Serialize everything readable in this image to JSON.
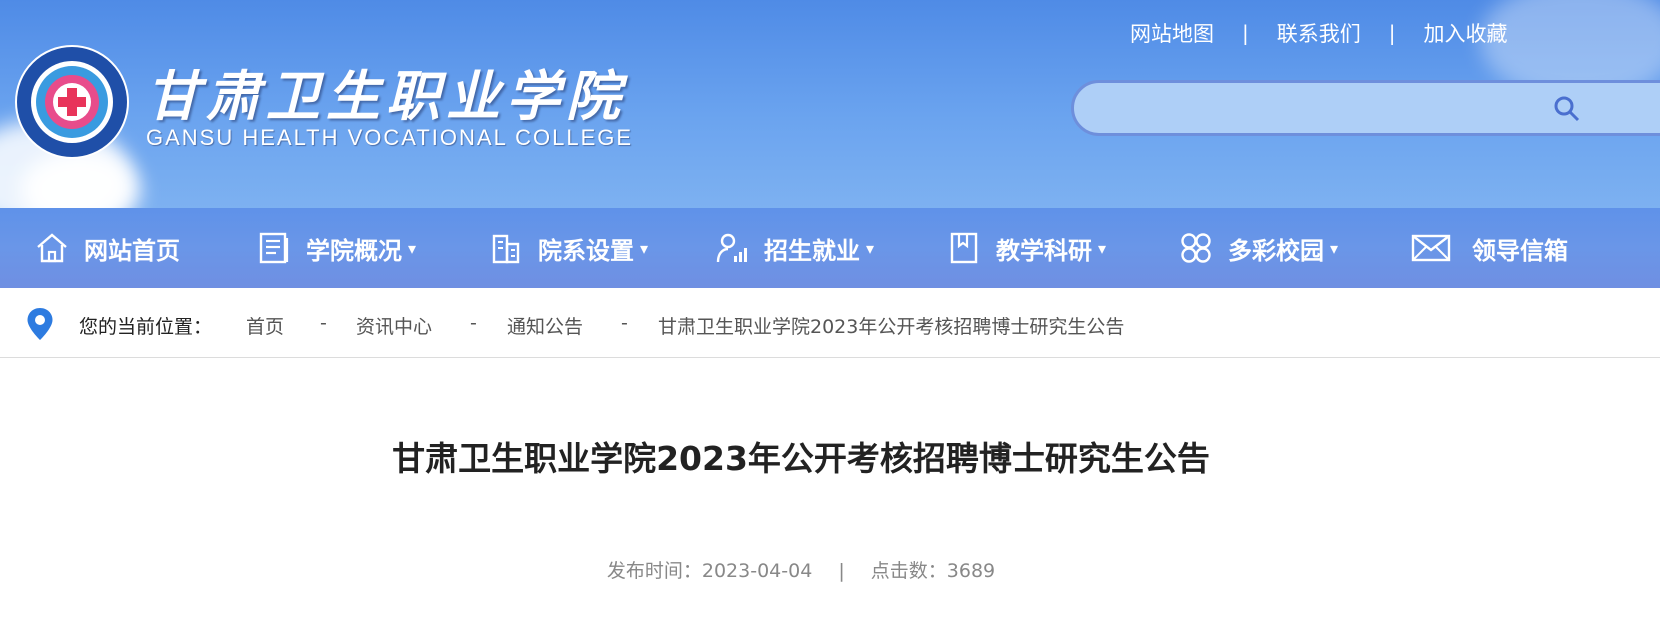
{
  "header": {
    "top_links": [
      "网站地图",
      "联系我们",
      "加入收藏"
    ],
    "separator": "|",
    "logo_cn": "甘肃卫生职业学院",
    "logo_en": "GANSU HEALTH VOCATIONAL COLLEGE",
    "emblem_text": "GANSU HEALTH VOCATIONAL COLLEGE",
    "search_placeholder": ""
  },
  "nav": {
    "items": [
      {
        "label": "网站首页",
        "icon": "home-icon"
      },
      {
        "label": "学院概况",
        "icon": "document-icon",
        "caret": "▾"
      },
      {
        "label": "院系设置",
        "icon": "building-icon",
        "caret": "▾"
      },
      {
        "label": "招生就业",
        "icon": "person-chart-icon",
        "caret": "▾"
      },
      {
        "label": "教学科研",
        "icon": "book-icon",
        "caret": "▾"
      },
      {
        "label": "多彩校园",
        "icon": "grid-circles-icon",
        "caret": "▾"
      },
      {
        "label": "领导信箱",
        "icon": "mail-icon"
      }
    ]
  },
  "breadcrumb": {
    "label": "您的当前位置：",
    "items": [
      "首页",
      "资讯中心",
      "通知公告",
      "甘肃卫生职业学院2023年公开考核招聘博士研究生公告"
    ],
    "separator": "-"
  },
  "article": {
    "title": "甘肃卫生职业学院2023年公开考核招聘博士研究生公告",
    "publish_label": "发布时间：",
    "publish_date": "2023-04-04",
    "separator": "|",
    "clicks_label": "点击数：",
    "clicks": "3689"
  },
  "colors": {
    "header_blue": "#4f8be6",
    "nav_blue": "#6a96e8",
    "pin_blue": "#2d7be0"
  }
}
